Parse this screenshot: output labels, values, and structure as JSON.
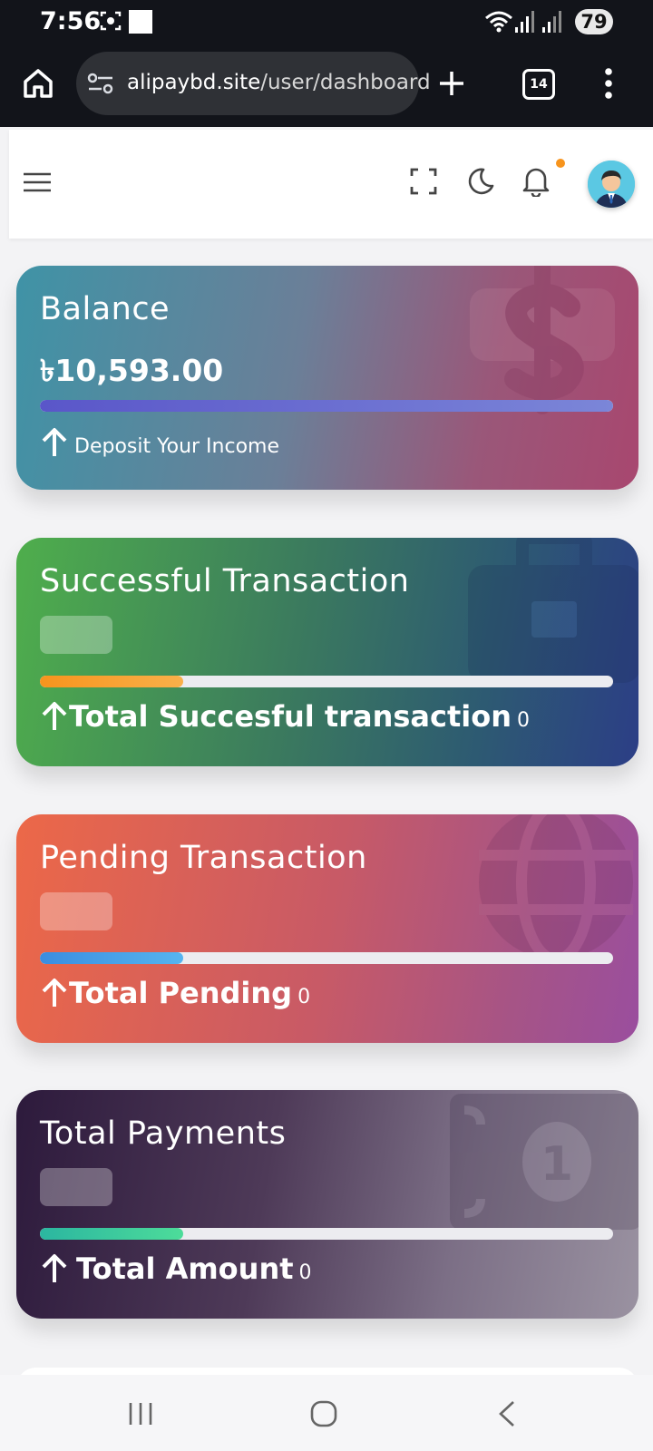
{
  "status_bar": {
    "time": "7:56",
    "battery": "79"
  },
  "browser": {
    "url_host": "alipaybd.site",
    "url_path": "/user/dashboard",
    "tab_count": "14"
  },
  "header": {
    "avatar_alt": "User avatar",
    "notification_dot_color": "#f7941d"
  },
  "cards": {
    "balance": {
      "title": "Balance",
      "amount": "৳10,593.00",
      "footer_text": "Deposit Your Income",
      "progress": 1.0,
      "gradient": [
        "#3f93a6",
        "#a8476f"
      ],
      "icon": "dollar-icon"
    },
    "successful": {
      "title": "Successful Transaction",
      "footer_label": "Total Succesful transaction",
      "footer_value": "0",
      "progress": 0.25,
      "gradient": [
        "#4fae4c",
        "#2c3e86"
      ],
      "icon": "briefcase-icon"
    },
    "pending": {
      "title": "Pending Transaction",
      "footer_label": "Total Pending",
      "footer_value": "0",
      "progress": 0.25,
      "gradient": [
        "#ec6848",
        "#9a4e9e"
      ],
      "icon": "globe-icon"
    },
    "payments": {
      "title": "Total Payments",
      "footer_label": "Total Amount",
      "footer_value": "0",
      "progress": 0.25,
      "gradient": [
        "#2d1a3c",
        "#9a92a1"
      ],
      "icon": "banknote-icon"
    }
  }
}
